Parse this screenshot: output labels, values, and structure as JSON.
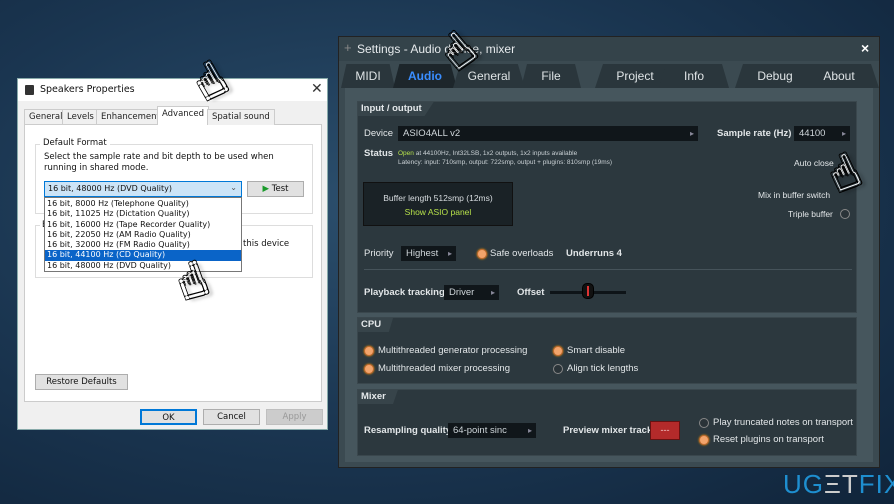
{
  "dialog": {
    "title": "Speakers Properties",
    "close_icon": "close-icon",
    "tabs": [
      "General",
      "Levels",
      "Enhancements",
      "Advanced",
      "Spatial sound"
    ],
    "active_tab": "Advanced",
    "default_format": {
      "label": "Default Format",
      "description": "Select the sample rate and bit depth to be used when running in shared mode.",
      "selected": "16 bit, 48000 Hz (DVD Quality)",
      "test_label": "Test",
      "options": [
        "16 bit, 8000 Hz (Telephone Quality)",
        "16 bit, 11025 Hz (Dictation Quality)",
        "16 bit, 16000 Hz (Tape Recorder Quality)",
        "16 bit, 22050 Hz (AM Radio Quality)",
        "16 bit, 32000 Hz (FM Radio Quality)",
        "16 bit, 44100 Hz (CD Quality)",
        "16 bit, 48000 Hz (DVD Quality)"
      ],
      "highlighted": "16 bit, 44100 Hz (CD Quality)"
    },
    "exclusive_group_label": "E",
    "exclusive_text": "this device",
    "restore_defaults": "Restore Defaults",
    "ok": "OK",
    "cancel": "Cancel",
    "apply": "Apply"
  },
  "fl": {
    "title": "Settings - Audio device, mixer",
    "close": "×",
    "tabs": [
      "MIDI",
      "Audio",
      "General",
      "File",
      "Project",
      "Info",
      "Debug",
      "About"
    ],
    "active_tab": "Audio",
    "io": {
      "header": "Input / output",
      "device_label": "Device",
      "device_value": "ASIO4ALL v2",
      "sample_rate_label": "Sample rate (Hz)",
      "sample_rate_value": "44100",
      "status_label": "Status",
      "status_open": "Open",
      "status_line1": " at 44100Hz, Int32LSB, 1x2 outputs, 1x2 inputs available",
      "status_line2": "Latency: input: 710smp, output: 722smp, output + plugins: 810smp (19ms)",
      "auto_close": "Auto close",
      "buffer_length": "Buffer length 512smp (12ms)",
      "show_asio": "Show ASIO panel",
      "mix_in_buffer": "Mix in buffer switch",
      "triple_buffer": "Triple buffer",
      "priority_label": "Priority",
      "priority_value": "Highest",
      "safe_overloads": "Safe overloads",
      "underruns": "Underruns 4",
      "playback_label": "Playback tracking",
      "playback_value": "Driver",
      "offset_label": "Offset"
    },
    "cpu": {
      "header": "CPU",
      "multi_gen": "Multithreaded generator processing",
      "multi_mixer": "Multithreaded mixer processing",
      "smart_disable": "Smart disable",
      "align_tick": "Align tick lengths"
    },
    "mixer": {
      "header": "Mixer",
      "resampling_label": "Resampling quality",
      "resampling_value": "64-point sinc",
      "preview_label": "Preview mixer track",
      "preview_value": "---",
      "play_truncated": "Play truncated notes on transport",
      "reset_plugins": "Reset plugins on transport"
    }
  },
  "watermark": "UGETFIX",
  "colors": {
    "accent_blue": "#3a8eff",
    "radio_on": "#f2a46b",
    "asio_green": "#b6e04a",
    "selection": "#0a64c8"
  }
}
